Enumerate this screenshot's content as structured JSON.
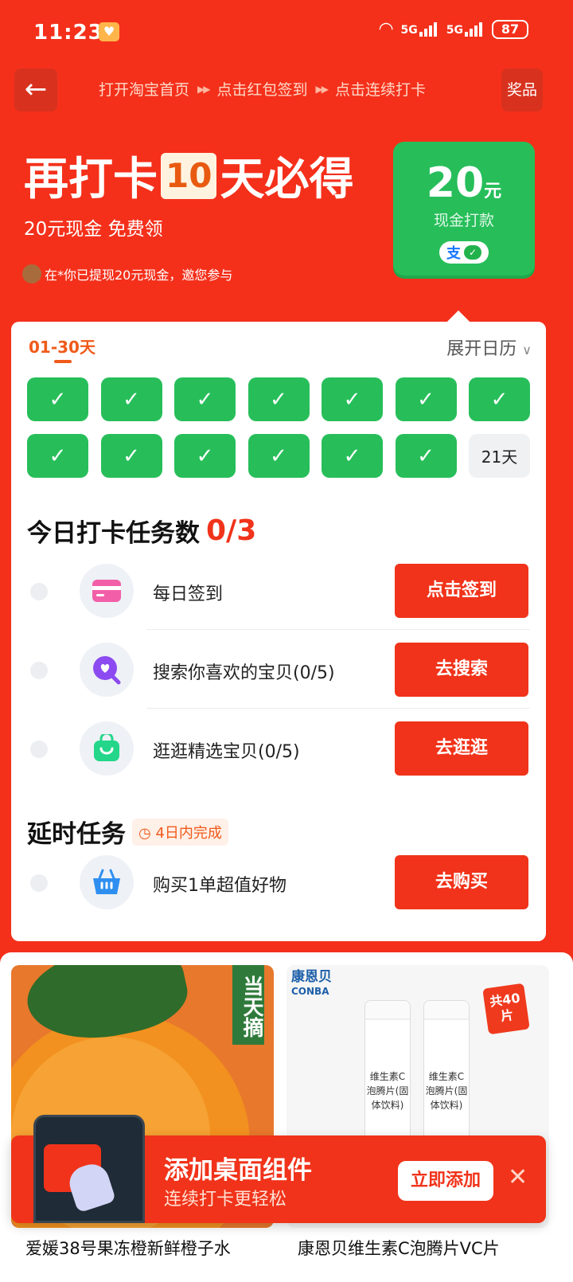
{
  "status_bar": {
    "time": "11:23",
    "network1": "5G",
    "network2": "5G",
    "battery": "87"
  },
  "nav": {
    "steps": [
      "打开淘宝首页",
      "点击红包签到",
      "点击连续打卡"
    ],
    "step_arrow": "▶▶",
    "prize_label": "奖品"
  },
  "hero": {
    "title_pre": "再打卡",
    "title_days": "10",
    "title_post": "天必得",
    "subtitle": "20元现金 免费领",
    "ticker": "在*你已提现20元现金，邀您参与"
  },
  "cash_card": {
    "amount": "20",
    "unit": "元",
    "label": "现金打款",
    "pay_alipay": "支",
    "pay_wechat": "✓"
  },
  "calendar": {
    "range_label": "01-30天",
    "expand_label": "展开日历",
    "days": [
      {
        "done": true,
        "label": "✓"
      },
      {
        "done": true,
        "label": "✓"
      },
      {
        "done": true,
        "label": "✓"
      },
      {
        "done": true,
        "label": "✓"
      },
      {
        "done": true,
        "label": "✓"
      },
      {
        "done": true,
        "label": "✓"
      },
      {
        "done": true,
        "label": "✓"
      },
      {
        "done": true,
        "label": "✓"
      },
      {
        "done": true,
        "label": "✓"
      },
      {
        "done": true,
        "label": "✓"
      },
      {
        "done": true,
        "label": "✓"
      },
      {
        "done": true,
        "label": "✓"
      },
      {
        "done": true,
        "label": "✓"
      },
      {
        "done": false,
        "label": "21天"
      }
    ]
  },
  "today_tasks": {
    "title": "今日打卡任务数",
    "count": "0/3",
    "items": [
      {
        "name": "每日签到",
        "button": "点击签到",
        "icon": "card-icon"
      },
      {
        "name": "搜索你喜欢的宝贝(0/5)",
        "button": "去搜索",
        "icon": "search-heart-icon"
      },
      {
        "name": "逛逛精选宝贝(0/5)",
        "button": "去逛逛",
        "icon": "shopping-bag-icon"
      }
    ]
  },
  "delayed_tasks": {
    "title": "延时任务",
    "tag": "4日内完成",
    "items": [
      {
        "name": "购买1单超值好物",
        "button": "去购买",
        "icon": "basket-icon"
      }
    ]
  },
  "products": [
    {
      "badge": "当天摘",
      "title": "爱媛38号果冻橙新鲜橙子水"
    },
    {
      "brand": "康恩贝",
      "brand_en": "CONBA",
      "tube_text": "维生素C泡腾片(固体饮料)",
      "burst": "共40片",
      "title": "康恩贝维生素C泡腾片VC片"
    }
  ],
  "widget_banner": {
    "title": "添加桌面组件",
    "subtitle": "连续打卡更轻松",
    "add_button": "立即添加",
    "close": "✕"
  },
  "colors": {
    "primary_red": "#f4301b",
    "button_red": "#f0331a",
    "check_green": "#27be5a",
    "accent_orange": "#f05a1a"
  }
}
